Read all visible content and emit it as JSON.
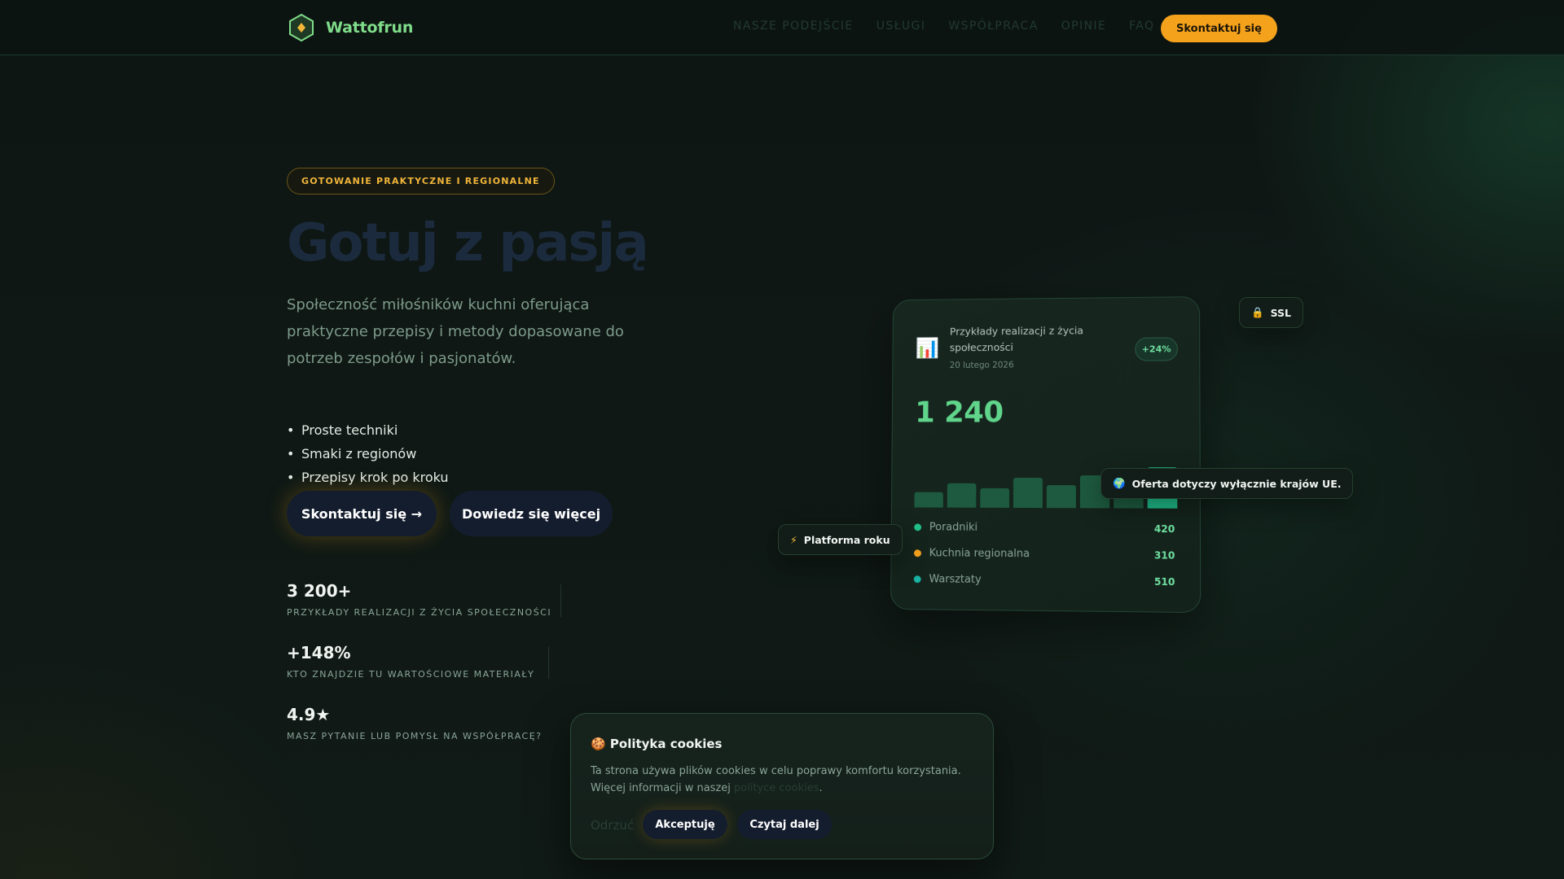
{
  "brand": {
    "name": "Wattofrun",
    "accent": "#7fdc8a"
  },
  "nav": {
    "items": [
      "NASZE PODEJŚCIE",
      "USŁUGI",
      "WSPÓŁPRACA",
      "OPINIE",
      "FAQ"
    ],
    "cta": "Skontaktuj się"
  },
  "hero": {
    "badge": "GOTOWANIE PRAKTYCZNE I REGIONALNE",
    "title": "Gotuj z pasją",
    "subtitle": "Społeczność miłośników kuchni oferująca praktyczne przepisy i metody dopasowane do potrzeb zespołów i pasjonatów.",
    "features": [
      "Proste techniki",
      "Smaki z regionów",
      "Przepisy krok po kroku"
    ],
    "primary_button": "Skontaktuj się →",
    "secondary_button": "Dowiedz się więcej"
  },
  "stats": [
    {
      "value": "3 200+",
      "label": "PRZYKŁADY REALIZACJI Z ŻYCIA SPOŁECZNOŚCI"
    },
    {
      "value": "+148%",
      "label": "KTO ZNAJDZIE TU WARTOŚCIOWE MATERIAŁY"
    },
    {
      "value": "4.9★",
      "label": "MASZ PYTANIE LUB POMYSŁ NA WSPÓŁPRACĘ?"
    }
  ],
  "card": {
    "icon": "bar-chart-icon",
    "title": "Przykłady realizacji z życia społeczności",
    "date": "20 lutego 2026",
    "delta": "+24%",
    "total": "1 240",
    "bars": [
      0.3,
      0.48,
      0.38,
      0.6,
      0.45,
      0.65,
      0.5,
      0.8
    ],
    "highlight_index": 7,
    "legend": [
      {
        "label": "Poradniki",
        "value": "420",
        "color": "#22c08a"
      },
      {
        "label": "Kuchnia regionalna",
        "value": "310",
        "color": "#f4a21c"
      },
      {
        "label": "Warsztaty",
        "value": "510",
        "color": "#18b3a3"
      }
    ]
  },
  "pills": {
    "ssl": {
      "icon": "lock-icon",
      "label": "SSL"
    },
    "eu": {
      "icon": "globe-icon",
      "label": "Oferta dotyczy wyłącznie krajów UE."
    },
    "platform": {
      "icon": "lightning-icon",
      "label": "Platforma roku"
    }
  },
  "cookies": {
    "title": "🍪 Polityka cookies",
    "text_before": "Ta strona używa plików cookies w celu poprawy komfortu korzystania. Więcej informacji w naszej",
    "link": "polityce cookies",
    "text_after": ".",
    "reject": "Odrzuć",
    "accept": "Akceptuję",
    "more": "Czytaj dalej"
  },
  "colors": {
    "cta_orange": "#f4a21c",
    "dark_button": "#141d2e",
    "green_value": "#5fd48a"
  }
}
